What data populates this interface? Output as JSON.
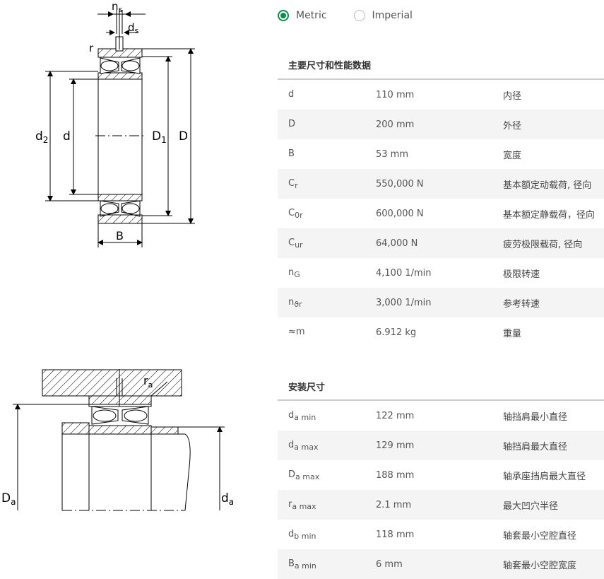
{
  "units": {
    "metric_label": "Metric",
    "imperial_label": "Imperial",
    "selected": "Metric",
    "accent_color": "#0a8f4a"
  },
  "drawing_labels": {
    "top": {
      "ns": "n",
      "ns_sub": "s",
      "ds": "d",
      "ds_sub": "s",
      "r": "r",
      "d2": "d",
      "d2_sub": "2",
      "d": "d",
      "D1": "D",
      "D1_sub": "1",
      "D": "D",
      "B": "B"
    },
    "bottom": {
      "ra": "r",
      "ra_sub": "a",
      "Da": "D",
      "Da_sub": "a",
      "da": "d",
      "da_sub": "a"
    }
  },
  "main_dimensions": {
    "title": "主要尺寸和性能数据",
    "rows": [
      {
        "sym": "d",
        "sub": "",
        "value": "110 mm",
        "desc": "内径"
      },
      {
        "sym": "D",
        "sub": "",
        "value": "200 mm",
        "desc": "外径"
      },
      {
        "sym": "B",
        "sub": "",
        "value": "53 mm",
        "desc": "宽度"
      },
      {
        "sym": "C",
        "sub": "r",
        "value": "550,000 N",
        "desc": "基本额定动载荷, 径向"
      },
      {
        "sym": "C",
        "sub": "0r",
        "value": "600,000 N",
        "desc": "基本额定静载荷，径向"
      },
      {
        "sym": "C",
        "sub": "ur",
        "value": "64,000 N",
        "desc": "疲劳极限载荷, 径向"
      },
      {
        "sym": "n",
        "sub": "G",
        "value": "4,100 1/min",
        "desc": "极限转速"
      },
      {
        "sym": "n",
        "sub": "ϑr",
        "value": "3,000 1/min",
        "desc": "参考转速"
      },
      {
        "sym": "≈m",
        "sub": "",
        "value": "6.912 kg",
        "desc": "重量"
      }
    ]
  },
  "mounting_dimensions": {
    "title": "安装尺寸",
    "rows": [
      {
        "sym": "d",
        "sub": "a min",
        "value": "122 mm",
        "desc": "轴挡肩最小直径"
      },
      {
        "sym": "d",
        "sub": "a max",
        "value": "129 mm",
        "desc": "轴挡肩最大直径"
      },
      {
        "sym": "D",
        "sub": "a max",
        "value": "188 mm",
        "desc": "轴承座挡肩最大直径"
      },
      {
        "sym": "r",
        "sub": "a max",
        "value": "2.1 mm",
        "desc": "最大凹穴半径"
      },
      {
        "sym": "d",
        "sub": "b min",
        "value": "118 mm",
        "desc": "轴套最小空腔直径"
      },
      {
        "sym": "B",
        "sub": "a min",
        "value": "6 mm",
        "desc": "轴套最小空腔宽度"
      }
    ]
  }
}
